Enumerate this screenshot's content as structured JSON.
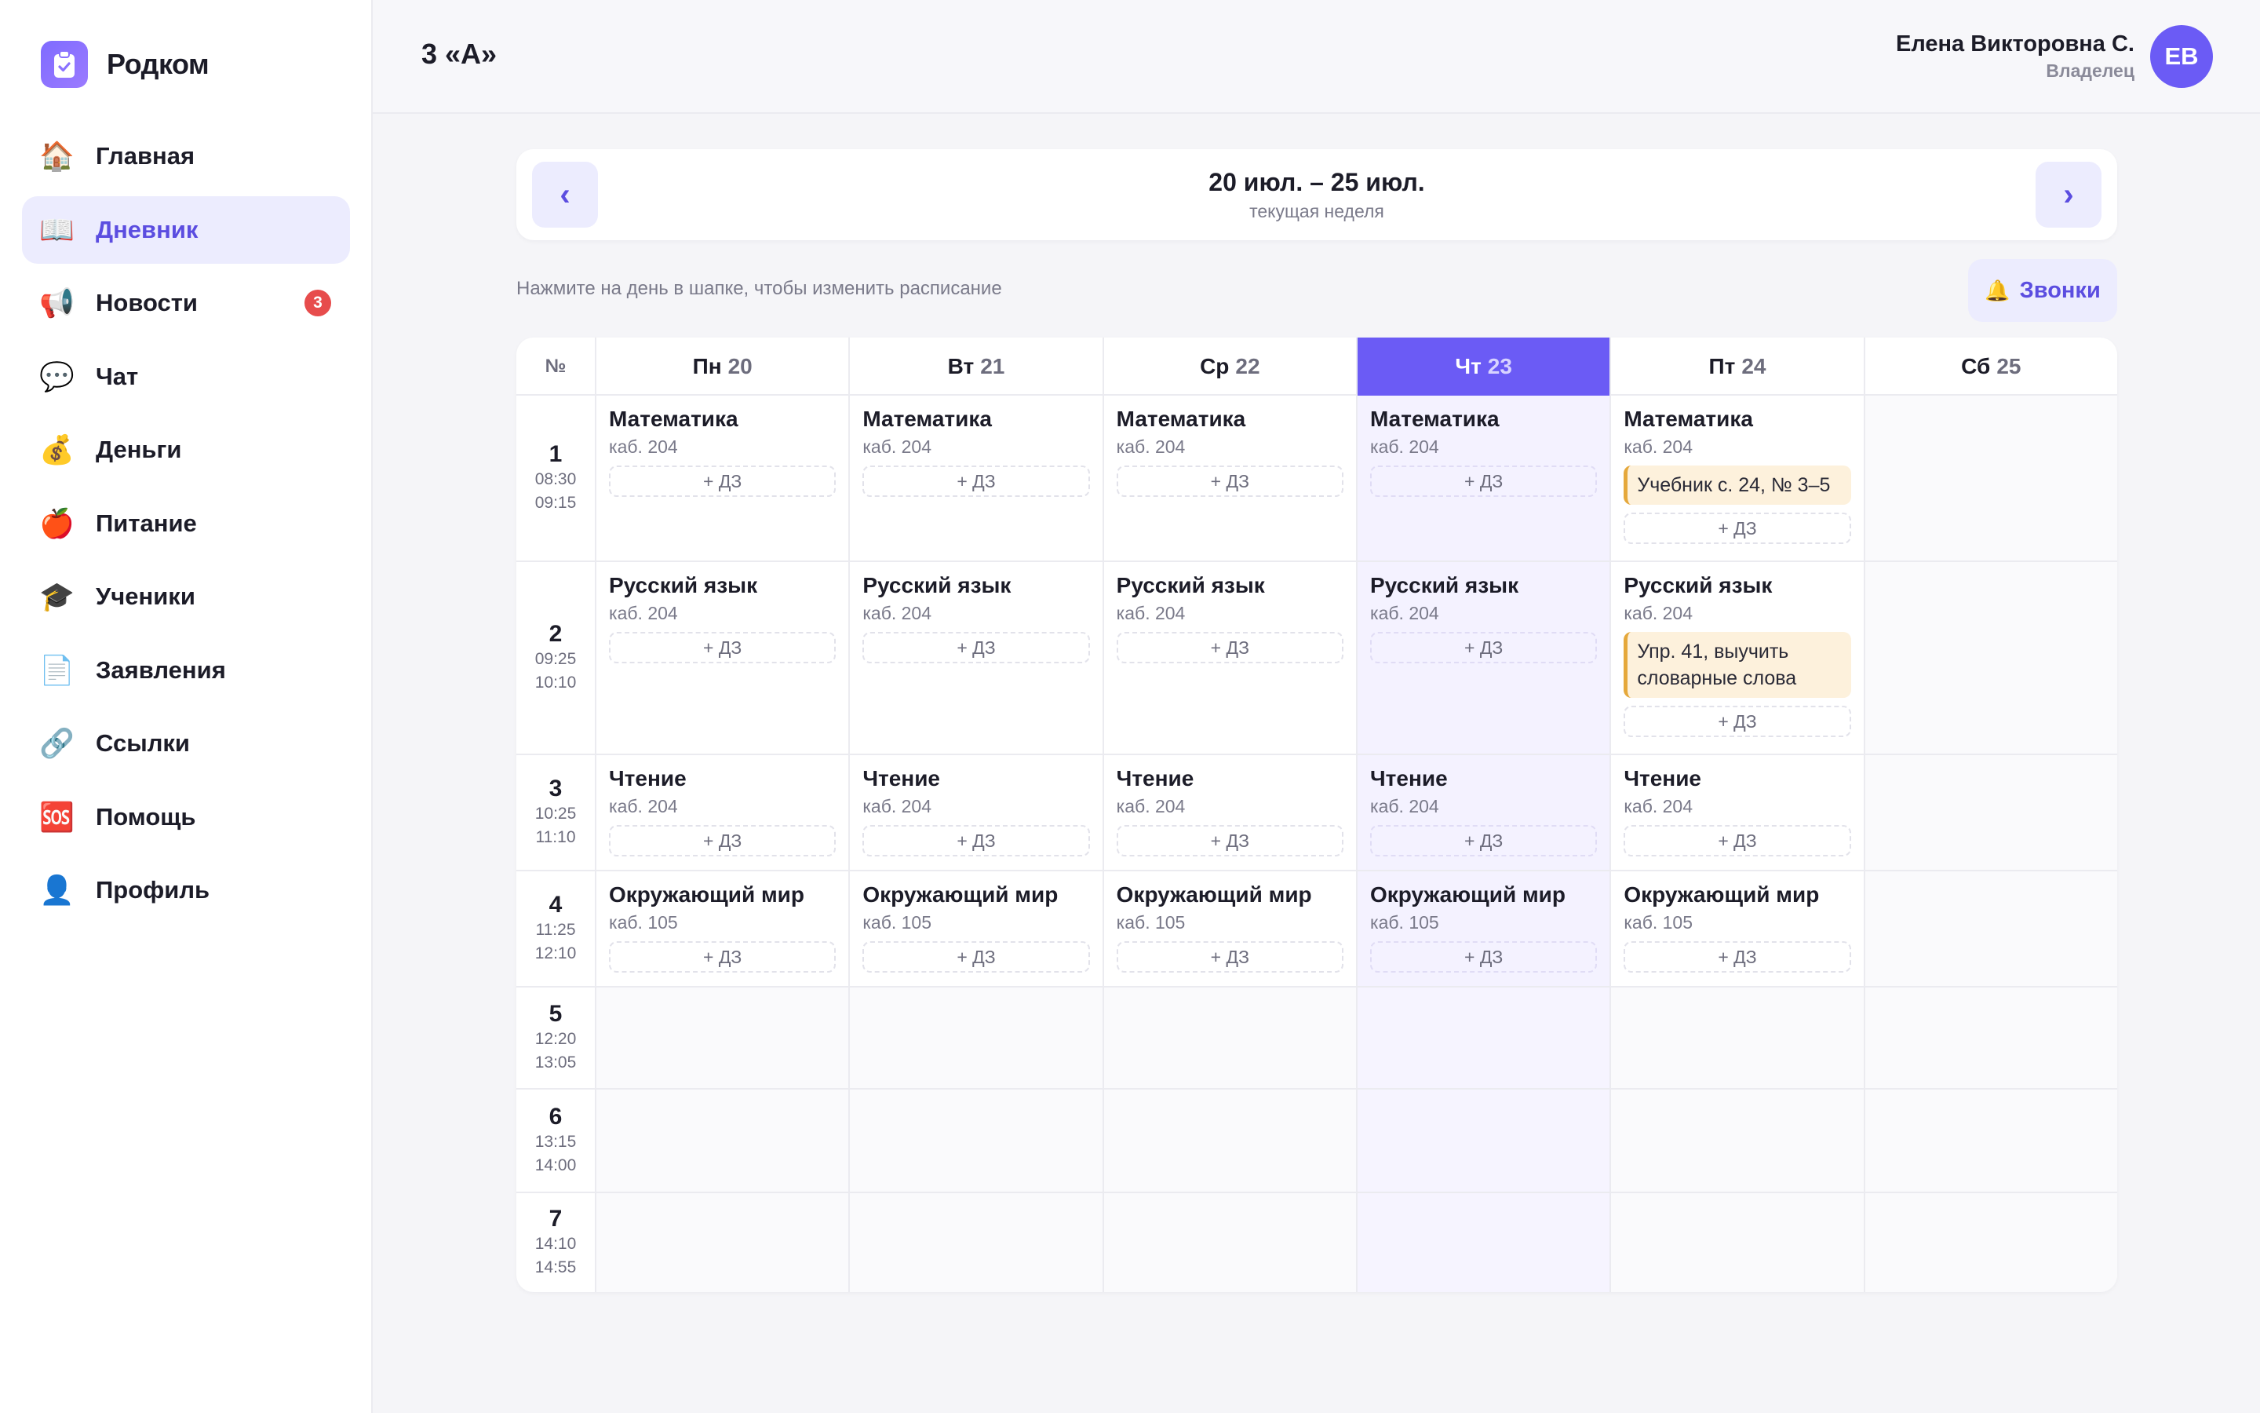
{
  "brand": {
    "name": "Родком"
  },
  "nav": [
    {
      "icon": "🏠",
      "icon_name": "home-icon",
      "label": "Главная",
      "active": false
    },
    {
      "icon": "📖",
      "icon_name": "book-icon",
      "label": "Дневник",
      "active": true
    },
    {
      "icon": "📢",
      "icon_name": "megaphone-icon",
      "label": "Новости",
      "active": false,
      "badge": "3"
    },
    {
      "icon": "💬",
      "icon_name": "speech-bubble-icon",
      "label": "Чат",
      "active": false
    },
    {
      "icon": "💰",
      "icon_name": "money-bag-icon",
      "label": "Деньги",
      "active": false
    },
    {
      "icon": "🍎",
      "icon_name": "apple-icon",
      "label": "Питание",
      "active": false
    },
    {
      "icon": "🎓",
      "icon_name": "graduation-cap-icon",
      "label": "Ученики",
      "active": false
    },
    {
      "icon": "📄",
      "icon_name": "document-icon",
      "label": "Заявления",
      "active": false
    },
    {
      "icon": "🔗",
      "icon_name": "link-icon",
      "label": "Ссылки",
      "active": false
    },
    {
      "icon": "🆘",
      "icon_name": "sos-icon",
      "label": "Помощь",
      "active": false
    },
    {
      "icon": "👤",
      "icon_name": "user-icon",
      "label": "Профиль",
      "active": false
    }
  ],
  "header": {
    "title": "3 «А»",
    "user_name": "Елена Викторовна С.",
    "user_role": "Владелец",
    "avatar_initials": "ЕВ"
  },
  "week": {
    "prev_label": "‹",
    "next_label": "›",
    "range": "20 июл. – 25 июл.",
    "subtitle": "текущая неделя"
  },
  "hint": "Нажмите на день в шапке, чтобы изменить расписание",
  "bells": {
    "icon": "🔔",
    "label": "Звонки"
  },
  "colors": {
    "accent": "#6b5bf5",
    "badge": "#e74c4c",
    "homework_bg": "#fdf1dc",
    "homework_border": "#e5a83b"
  },
  "schedule": {
    "no_header": "№",
    "add_hw_label": "+ ДЗ",
    "days": [
      {
        "name": "Пн",
        "num": "20",
        "today": false
      },
      {
        "name": "Вт",
        "num": "21",
        "today": false
      },
      {
        "name": "Ср",
        "num": "22",
        "today": false
      },
      {
        "name": "Чт",
        "num": "23",
        "today": true
      },
      {
        "name": "Пт",
        "num": "24",
        "today": false
      },
      {
        "name": "Сб",
        "num": "25",
        "today": false
      }
    ],
    "lessons": [
      {
        "num": "1",
        "start": "08:30",
        "end": "09:15",
        "cells": [
          {
            "subject": "Математика",
            "room": "каб. 204"
          },
          {
            "subject": "Математика",
            "room": "каб. 204"
          },
          {
            "subject": "Математика",
            "room": "каб. 204"
          },
          {
            "subject": "Математика",
            "room": "каб. 204"
          },
          {
            "subject": "Математика",
            "room": "каб. 204",
            "homework": "Учебник с. 24, № 3–5"
          },
          null
        ]
      },
      {
        "num": "2",
        "start": "09:25",
        "end": "10:10",
        "cells": [
          {
            "subject": "Русский язык",
            "room": "каб. 204"
          },
          {
            "subject": "Русский язык",
            "room": "каб. 204"
          },
          {
            "subject": "Русский язык",
            "room": "каб. 204"
          },
          {
            "subject": "Русский язык",
            "room": "каб. 204"
          },
          {
            "subject": "Русский язык",
            "room": "каб. 204",
            "homework": "Упр. 41, выучить словарные слова"
          },
          null
        ]
      },
      {
        "num": "3",
        "start": "10:25",
        "end": "11:10",
        "cells": [
          {
            "subject": "Чтение",
            "room": "каб. 204"
          },
          {
            "subject": "Чтение",
            "room": "каб. 204"
          },
          {
            "subject": "Чтение",
            "room": "каб. 204"
          },
          {
            "subject": "Чтение",
            "room": "каб. 204"
          },
          {
            "subject": "Чтение",
            "room": "каб. 204"
          },
          null
        ]
      },
      {
        "num": "4",
        "start": "11:25",
        "end": "12:10",
        "cells": [
          {
            "subject": "Окружающий мир",
            "room": "каб. 105"
          },
          {
            "subject": "Окружающий мир",
            "room": "каб. 105"
          },
          {
            "subject": "Окружающий мир",
            "room": "каб. 105"
          },
          {
            "subject": "Окружающий мир",
            "room": "каб. 105"
          },
          {
            "subject": "Окружающий мир",
            "room": "каб. 105"
          },
          null
        ]
      },
      {
        "num": "5",
        "start": "12:20",
        "end": "13:05",
        "cells": [
          null,
          null,
          null,
          null,
          null,
          null
        ]
      },
      {
        "num": "6",
        "start": "13:15",
        "end": "14:00",
        "cells": [
          null,
          null,
          null,
          null,
          null,
          null
        ]
      },
      {
        "num": "7",
        "start": "14:10",
        "end": "14:55",
        "cells": [
          null,
          null,
          null,
          null,
          null,
          null
        ]
      }
    ]
  }
}
